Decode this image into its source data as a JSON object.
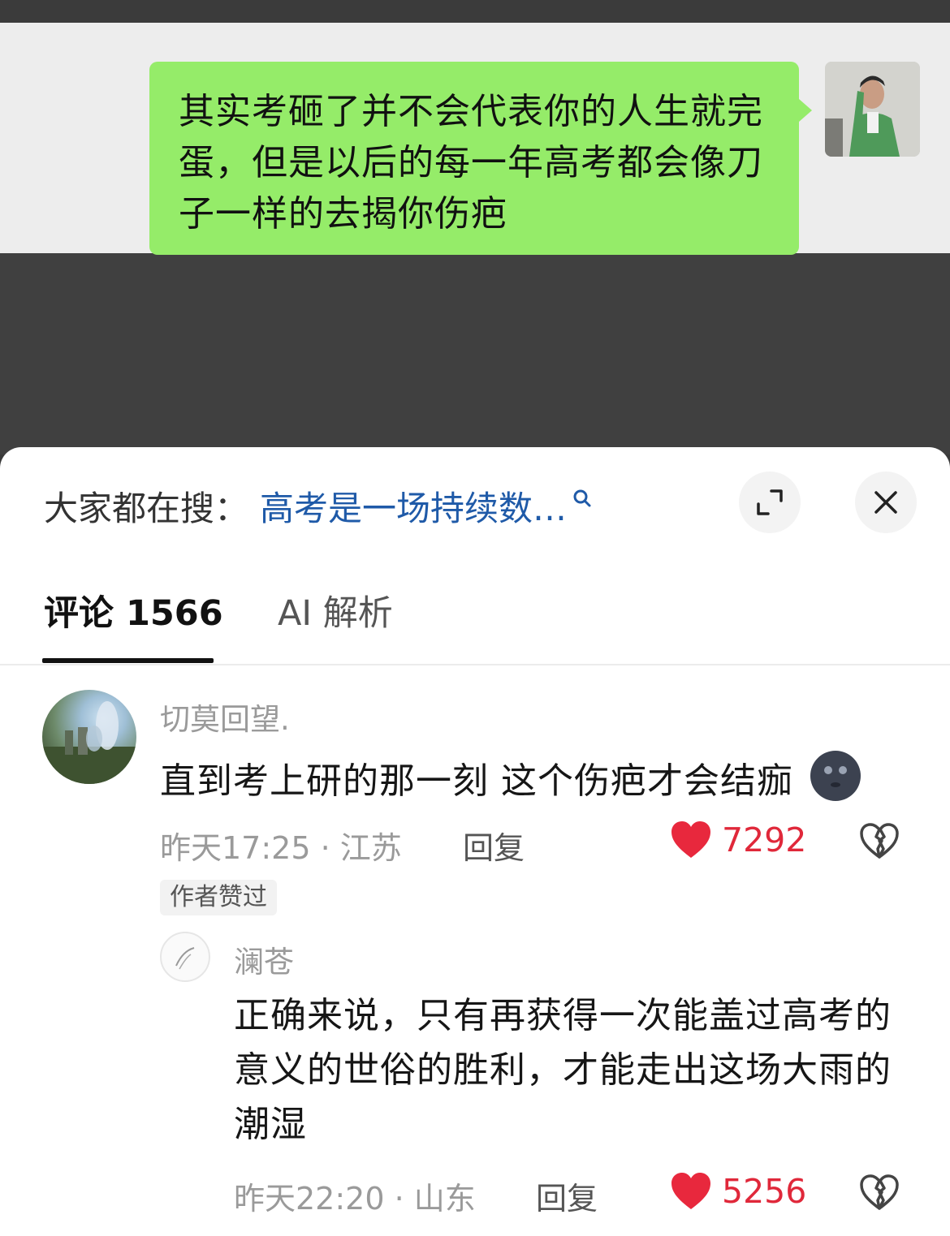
{
  "chat": {
    "message": "其实考砸了并不会代表你的人生就完蛋，但是以后的每一年高考都会像刀子一样的去揭你伤疤"
  },
  "search": {
    "label": "大家都在搜：",
    "query": "高考是一场持续数…"
  },
  "tabs": {
    "comments": "评论 1566",
    "ai": "AI 解析"
  },
  "comments": [
    {
      "username": "切莫回望.",
      "text": "直到考上研的那一刻 这个伤疤才会结痂",
      "time_location": "昨天17:25 · 江苏",
      "reply": "回复",
      "likes": "7292",
      "badge": "作者赞过"
    },
    {
      "username": "澜苍",
      "text": "正确来说，只有再获得一次能盖过高考的意义的世俗的胜利，才能走出这场大雨的潮湿",
      "time_location": "昨天22:20 · 山东",
      "reply": "回复",
      "likes": "5256"
    }
  ],
  "colors": {
    "bubble": "#95ec69",
    "link_blue": "#1f5aa8",
    "like_red": "#e0283a"
  },
  "icons": [
    "search-icon",
    "expand-icon",
    "close-icon",
    "heart-icon",
    "broken-heart-icon",
    "emoji-icon"
  ]
}
